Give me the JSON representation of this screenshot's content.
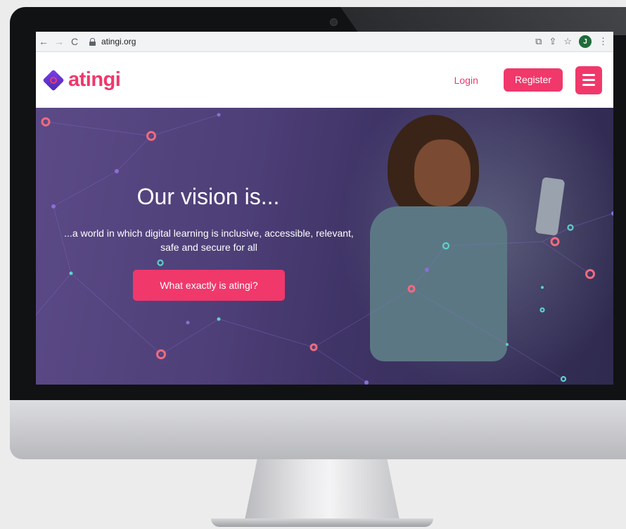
{
  "browser": {
    "url": "atingi.org",
    "back_icon": "←",
    "forward_icon": "→",
    "reload_icon": "C",
    "profile_initial": "J"
  },
  "site": {
    "logo_text": "atingi",
    "login_label": "Login",
    "register_label": "Register"
  },
  "hero": {
    "title": "Our vision is...",
    "subtitle_line1": "...a world in which digital learning is inclusive, accessible, relevant,",
    "subtitle_line2": "safe and secure for all",
    "cta_label": "What exactly is atingi?"
  },
  "colors": {
    "brand_pink": "#f0386b",
    "brand_purple": "#5b3fb8",
    "hero_overlay": "#4e3f78"
  }
}
